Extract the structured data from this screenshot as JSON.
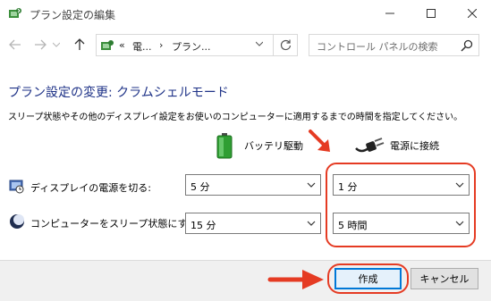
{
  "window": {
    "title": "プラン設定の編集",
    "controls": {
      "minimize": "minimize",
      "maximize": "maximize",
      "close": "close"
    }
  },
  "nav": {
    "address": {
      "overflow": "«",
      "crumb1": "電...",
      "separator": "›",
      "crumb2": "プラン..."
    },
    "search_placeholder": "コントロール パネルの検索"
  },
  "content": {
    "heading": "プラン設定の変更: クラムシェルモード",
    "description": "スリープ状態やその他のディスプレイ設定をお使いのコンピューターに適用するまでの時間を指定してください。",
    "columns": {
      "battery": "バッテリ駆動",
      "plugged": "電源に接続"
    },
    "rows": [
      {
        "label": "ディスプレイの電源を切る:",
        "battery_value": "5 分",
        "plugged_value": "1 分"
      },
      {
        "label": "コンピューターをスリープ状態にする:",
        "battery_value": "15 分",
        "plugged_value": "5 時間"
      }
    ]
  },
  "buttons": {
    "create": "作成",
    "cancel": "キャンセル"
  },
  "colors": {
    "heading": "#1e3287",
    "annotation": "#e53b23",
    "default_button_border": "#0078d7"
  }
}
